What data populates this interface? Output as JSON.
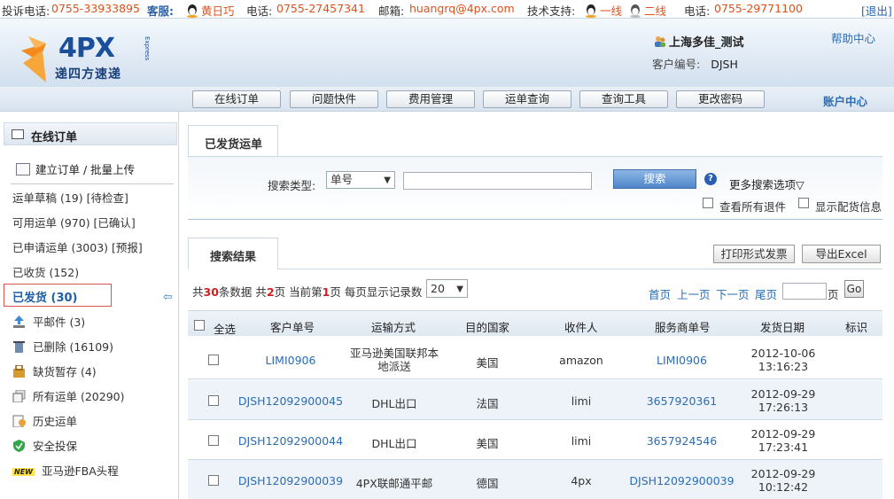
{
  "topbar": {
    "complaint_label": "投诉电话:",
    "complaint_phone": "0755-33933895",
    "service_label": "客服:",
    "service_name": "黄日巧",
    "phone_label": "电话:",
    "service_phone": "0755-27457341",
    "email_label": "邮箱:",
    "email": "huangrq@4px.com",
    "tech_label": "技术支持:",
    "tech_line1": "一线",
    "tech_line2": "二线",
    "tech_phone_label": "电话:",
    "tech_phone": "0755-29771100",
    "logout": "[退出]"
  },
  "header": {
    "logo_text": "4PX",
    "logo_sub": "递四方速递",
    "logo_express": "Express",
    "company": "上海多佳_测试",
    "customer_no_label": "客户编号:",
    "customer_no": "DJSH",
    "help": "帮助中心"
  },
  "nav": {
    "items": [
      "在线订单",
      "问题快件",
      "费用管理",
      "运单查询",
      "查询工具",
      "更改密码"
    ],
    "account": "账户中心"
  },
  "sidebar": {
    "title": "在线订单",
    "create": "建立订单 / 批量上传",
    "draft": "运单草稿 (19) [待检查]",
    "available": "可用运单 (970) [已确认]",
    "applied": "已申请运单 (3003) [预报]",
    "received": "已收货 (152)",
    "shipped": "已发货 (30)",
    "flat": "平邮件 (3)",
    "deleted": "已删除 (16109)",
    "shortage": "缺货暂存 (4)",
    "all": "所有运单 (20290)",
    "history": "历史运单",
    "insurance": "安全投保",
    "fba_badge": "NEW",
    "fba": "亚马逊FBA头程"
  },
  "main": {
    "tab_title": "已发货运单",
    "search_type_label": "搜索类型:",
    "search_type_value": "单号",
    "search_button": "搜索",
    "more_options": "更多搜索选项",
    "view_returns": "查看所有退件",
    "show_distribution": "显示配货信息",
    "results_tab": "搜索结果",
    "print_invoice": "打印形式发票",
    "export_excel": "导出Excel"
  },
  "stats": {
    "total_prefix": "共",
    "total_count": "30",
    "total_suffix": "条数据",
    "pages_prefix": "共",
    "pages": "2",
    "pages_suffix": "页",
    "current_prefix": "当前第",
    "current": "1",
    "current_suffix": "页",
    "per_page_label": "每页显示记录数",
    "per_page": "20"
  },
  "pager": {
    "first": "首页",
    "prev": "上一页",
    "next": "下一页",
    "last": "尾页",
    "page_label": "页",
    "go": "Go"
  },
  "table": {
    "headers": [
      "全选",
      "客户单号",
      "运输方式",
      "目的国家",
      "收件人",
      "服务商单号",
      "发货日期",
      "标识"
    ],
    "rows": [
      {
        "order": "LIMI0906",
        "method": "亚马逊美国联邦本地派送",
        "country": "美国",
        "recipient": "amazon",
        "provider_no": "LIMI0906",
        "date": "2012-10-06",
        "time": "13:16:23"
      },
      {
        "order": "DJSH12092900045",
        "method": "DHL出口",
        "country": "法国",
        "recipient": "limi",
        "provider_no": "3657920361",
        "date": "2012-09-29",
        "time": "17:26:13"
      },
      {
        "order": "DJSH12092900044",
        "method": "DHL出口",
        "country": "美国",
        "recipient": "limi",
        "provider_no": "3657924546",
        "date": "2012-09-29",
        "time": "17:23:41"
      },
      {
        "order": "DJSH12092900039",
        "method": "4PX联邮通平邮",
        "country": "德国",
        "recipient": "4px",
        "provider_no": "DJSH12092900039",
        "date": "2012-09-29",
        "time": "10:12:42"
      }
    ]
  }
}
